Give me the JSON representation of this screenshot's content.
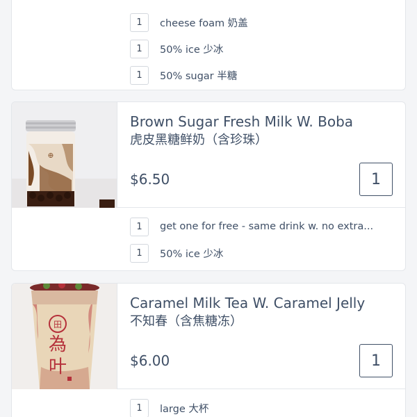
{
  "cards": [
    {
      "options": [
        {
          "qty": "1",
          "label": "cheese foam 奶盖"
        },
        {
          "qty": "1",
          "label": "50% ice 少冰"
        },
        {
          "qty": "1",
          "label": "50% sugar 半糖"
        }
      ]
    },
    {
      "title": "Brown Sugar Fresh Milk W. Boba",
      "subtitle": "虎皮黑糖鲜奶（含珍珠）",
      "price": "$6.50",
      "quantity": "1",
      "image_icon": "brown-sugar-milk-drink",
      "options": [
        {
          "qty": "1",
          "label": "get one for free - same drink w. no extra..."
        },
        {
          "qty": "1",
          "label": "50% ice 少冰"
        }
      ]
    },
    {
      "title": "Caramel Milk Tea W. Caramel Jelly",
      "subtitle": "不知春（含焦糖冻）",
      "price": "$6.00",
      "quantity": "1",
      "image_icon": "caramel-milk-tea-drink",
      "options": [
        {
          "qty": "1",
          "label": "large 大杯"
        }
      ]
    }
  ],
  "colors": {
    "text": "#3f4f66",
    "border": "#e3e6ea",
    "background": "#f4f5f7"
  }
}
